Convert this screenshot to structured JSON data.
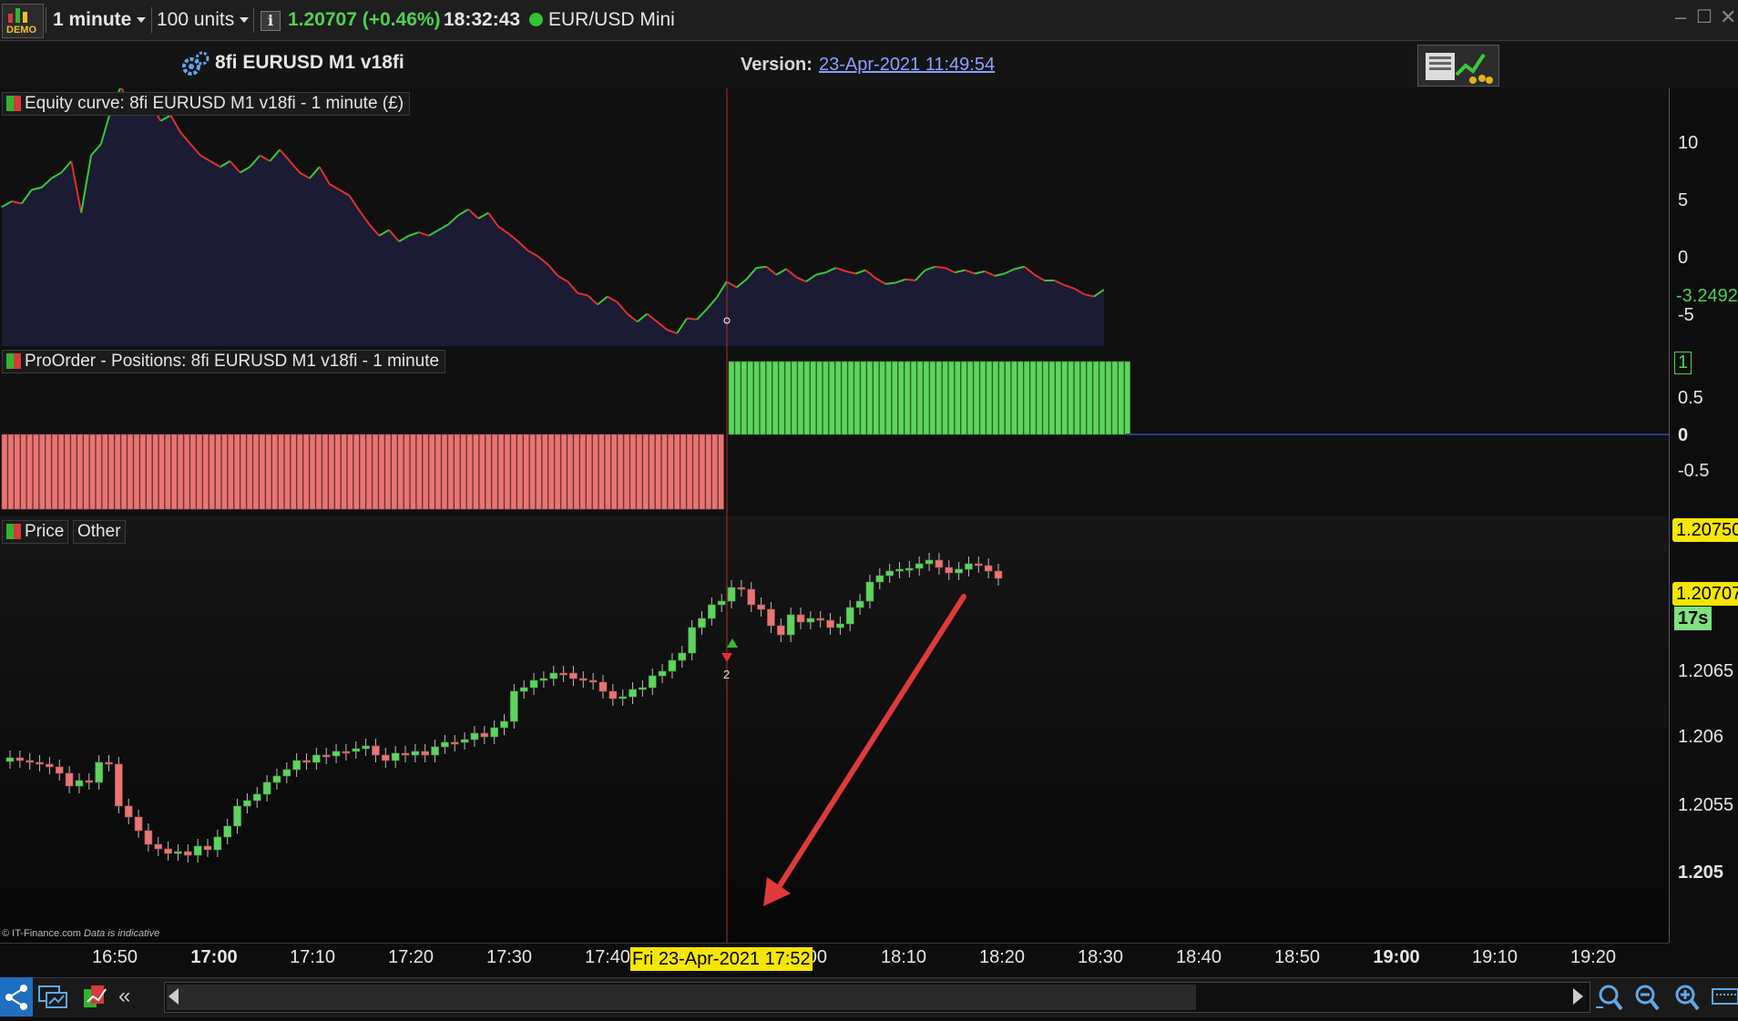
{
  "toolbar": {
    "demo_label": "DEMO",
    "timeframe": "1 minute",
    "units": "100 units",
    "price": "1.20707 (+0.46%)",
    "time": "18:32:43",
    "instrument": "EUR/USD Mini"
  },
  "header": {
    "system_name": "8fi EURUSD M1 v18fi",
    "version_label": "Version:",
    "version_value": "23-Apr-2021 11:49:54"
  },
  "panels": {
    "equity_label": "Equity curve: 8fi EURUSD M1 v18fi - 1 minute (£)",
    "positions_label": "ProOrder - Positions: 8fi EURUSD M1 v18fi - 1 minute",
    "price_label": "Price",
    "other_label": "Other"
  },
  "axes": {
    "equity_ticks": [
      "10",
      "5",
      "0",
      "-5"
    ],
    "equity_current": "-3.2492",
    "positions_ticks": [
      "1",
      "0.5",
      "0",
      "-0.5"
    ],
    "price_ticks": [
      "1.2065",
      "1.206",
      "1.2055",
      "1.205"
    ],
    "price_badge_high": "1.20750",
    "price_badge_current": "1.20707",
    "countdown": "17s",
    "time_ticks": [
      "16:50",
      "17:00",
      "17:10",
      "17:20",
      "17:30",
      "17:40",
      "18:00",
      "18:10",
      "18:20",
      "18:30",
      "18:40",
      "18:50",
      "19:00",
      "19:10",
      "19:20"
    ],
    "cursor_date": "Fri 23-Apr-2021 17:52",
    "trade_marker": "2"
  },
  "copyright": "© IT-Finance.com",
  "disclaimer": "Data is indicative",
  "colors": {
    "up": "#5fd35f",
    "down": "#e87575",
    "badge_yellow": "#f5e600",
    "arrow": "#e03a3a"
  }
}
